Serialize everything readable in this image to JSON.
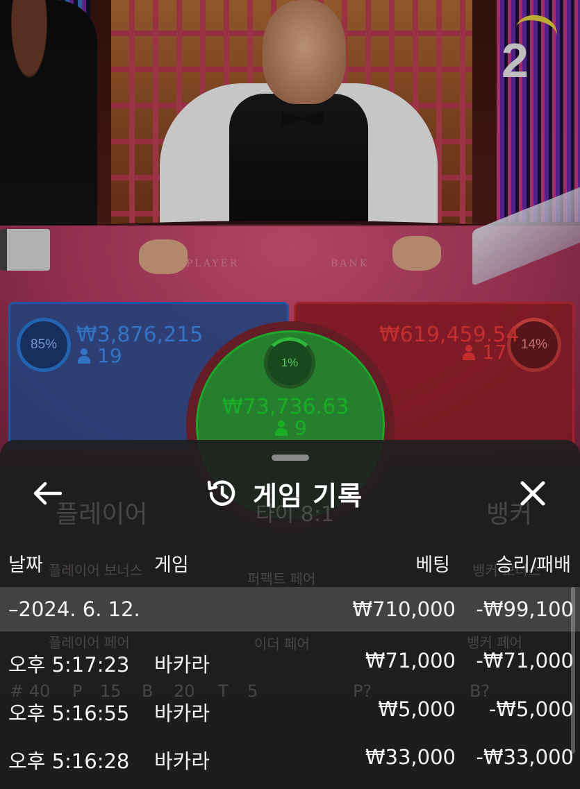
{
  "table": {
    "round_number": "2",
    "felt_labels": {
      "player": "PLAYER",
      "banker": "BANK"
    }
  },
  "bets": {
    "player": {
      "percent": "85%",
      "amount": "₩3,876,215",
      "players": "19",
      "color": "#3d8df0"
    },
    "banker": {
      "percent": "14%",
      "amount": "₩619,459.54",
      "players": "17",
      "color": "#ee3a3a"
    },
    "tie": {
      "percent": "1%",
      "amount": "₩73,736.63",
      "players": "9",
      "color": "#1ed62e"
    }
  },
  "underlay": {
    "labels": [
      "플레이어",
      "타이 8:1",
      "뱅커",
      "플레이어 보너스",
      "퍼펙트 페어",
      "뱅커 보너스",
      "플레이어 페어",
      "이더 페어",
      "뱅커 페어"
    ],
    "road_counts": [
      "# 40",
      "P",
      "15",
      "B",
      "20",
      "T",
      "5",
      "P?",
      "B?"
    ]
  },
  "history_sheet": {
    "title": "게임 기록",
    "back_icon": "arrow-left-icon",
    "history_icon": "history-clock-icon",
    "close_icon": "close-icon",
    "columns": {
      "date": "날짜",
      "game": "게임",
      "bet": "베팅",
      "result": "승리/패배"
    },
    "summary": {
      "date": "–2024. 6. 12.",
      "bet": "₩710,000",
      "result": "-₩99,100"
    },
    "rows": [
      {
        "time": "오후 5:17:23",
        "game": "바카라",
        "bet": "₩71,000",
        "result": "-₩71,000"
      },
      {
        "time": "오후 5:16:55",
        "game": "바카라",
        "bet": "₩5,000",
        "result": "-₩5,000"
      },
      {
        "time": "오후 5:16:28",
        "game": "바카라",
        "bet": "₩33,000",
        "result": "-₩33,000"
      }
    ]
  }
}
